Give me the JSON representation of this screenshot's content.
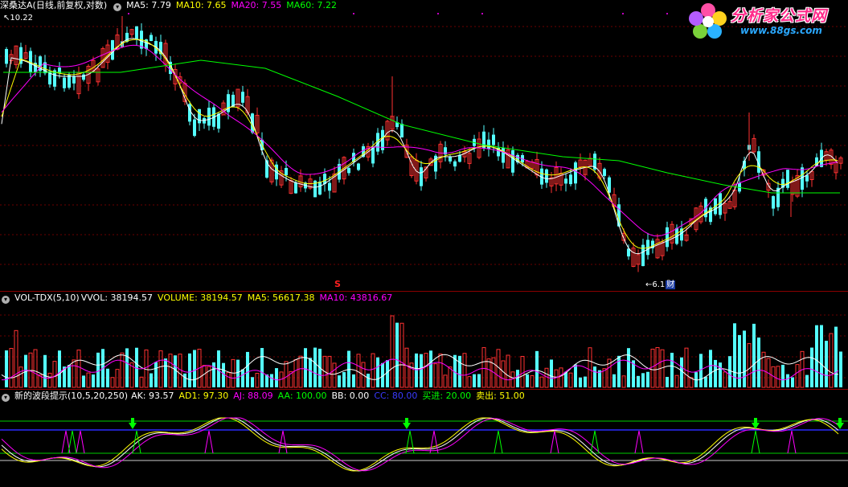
{
  "price_header": {
    "stock_name": "深桑达A",
    "period": "(日线,前复权,对数)",
    "ma5": "MA5: 7.79",
    "ma10": "MA10: 7.65",
    "ma20": "MA20: 7.55",
    "ma60": "MA60: 7.22",
    "high_label": "10.22",
    "low_label": "6.1",
    "low_badge": "财",
    "event_marker": "S"
  },
  "volume_header": {
    "name": "VOL-TDX(5,10)",
    "vvol": "VVOL: 38194.57",
    "volume": "VOLUME: 38194.57",
    "ma5": "MA5: 56617.38",
    "ma10": "MA10: 43816.67"
  },
  "indicator_header": {
    "name": "新的波段提示(10,5,20,250)",
    "ak": "AK: 93.57",
    "ad1": "AD1: 97.30",
    "aj": "AJ: 88.09",
    "aa": "AA: 100.00",
    "bb": "BB: 0.00",
    "cc": "CC: 80.00",
    "buy": "买进: 20.00",
    "sell": "卖出: 51.00"
  },
  "logo": {
    "title": "分析家公式网",
    "url": "www.88gs.com"
  },
  "colors": {
    "up": "#ff3232",
    "down": "#54ffff",
    "ma5": "#ffffff",
    "ma10": "#ffff00",
    "ma20": "#ff00ff",
    "ma60": "#00ff00",
    "ak": "#ffffff",
    "ad1": "#ffff00",
    "aj": "#ff00ff",
    "aa": "#00ff00",
    "bb": "#ffffff",
    "cc": "#0000ff",
    "buy": "#00ff00",
    "sell": "#ffff00",
    "separator": "#8a0000"
  }
}
